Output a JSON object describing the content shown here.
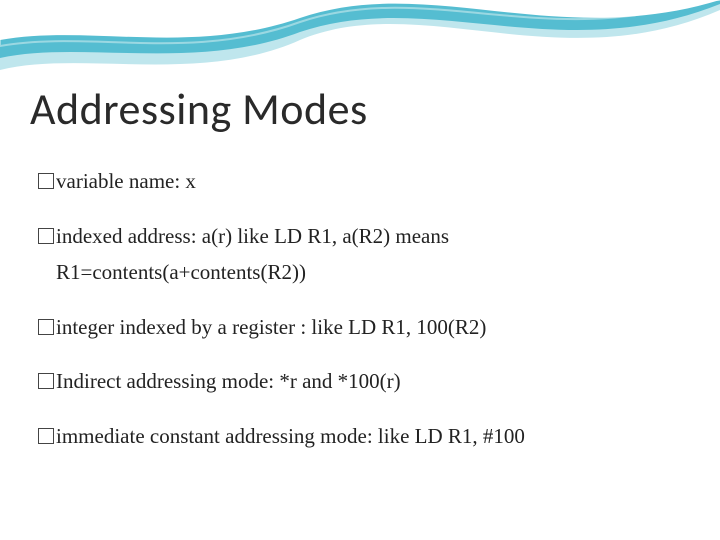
{
  "title": "Addressing Modes",
  "bullets": [
    {
      "line1": "variable name: x"
    },
    {
      "line1": "indexed address: a(r) like LD R1, a(R2) means",
      "line2": "R1=contents(a+contents(R2))"
    },
    {
      "line1": "integer  indexed by a register : like LD R1, 100(R2)"
    },
    {
      "line1": "Indirect addressing mode: *r and *100(r)"
    },
    {
      "line1": "immediate constant addressing mode: like LD R1, #100"
    }
  ],
  "theme": {
    "wave_outer": "#4fb9cf",
    "wave_mid": "#d6eef2",
    "wave_inner": "#ffffff",
    "title_color": "#2a2a2a"
  }
}
